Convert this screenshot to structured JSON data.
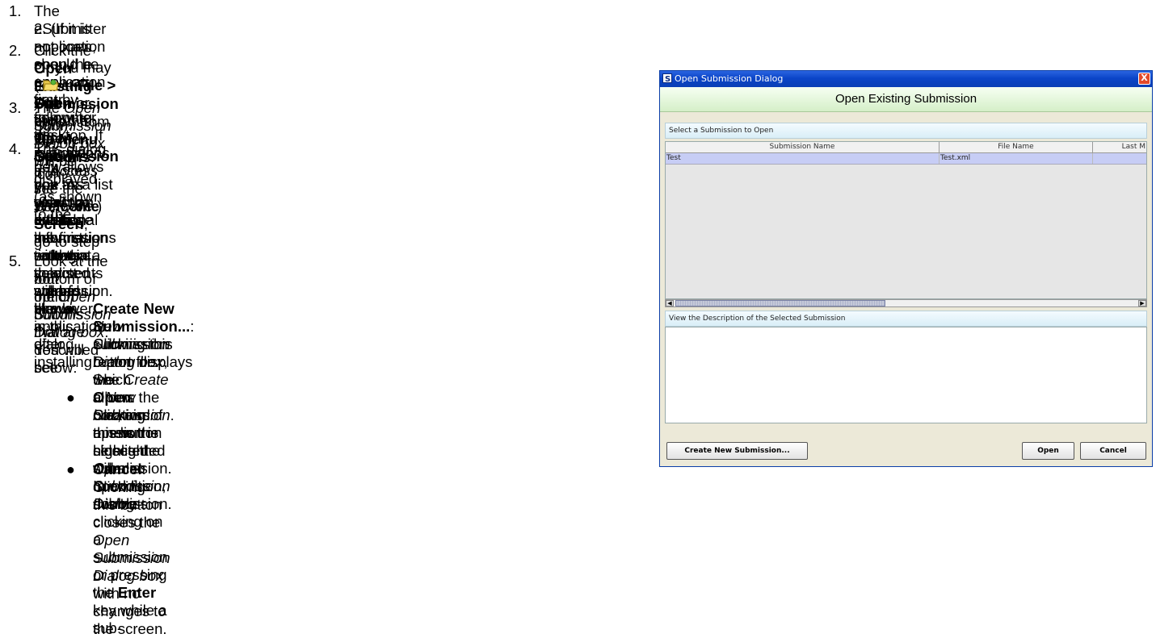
{
  "steps": [
    {
      "num": "1.",
      "lines": [
        [
          "The eSubmitter application should be open on your computer desktop. If it is open, and you see the ",
          {
            "b": "Welcome Screen"
          },
          ", go to step"
        ],
        [
          "2. (If it is not open, open the application first by following the instructions in ",
          {
            "i": "Access the Software"
          },
          ".)"
        ]
      ]
    },
    {
      "num": "2.",
      "lines": [
        [
          "Click the ",
          {
            "b": "Open Existing Submission"
          },
          " button from the ",
          {
            "b": "Menu Options"
          },
          "."
        ],
        [
          "Or you may select ",
          {
            "b": "File > Open"
          },
          " or, click the ",
          {
            "b": "Open Submission"
          },
          " icon"
        ],
        [
          "( ",
          {
            "icon": "folder"
          },
          " ) on the Tool Bar."
        ]
      ]
    },
    {
      "num": "3.",
      "lines": [
        [
          "The ",
          {
            "i": "Open Submission Dialog box"
          },
          " will be displayed (as shown to the"
        ],
        [
          "right)."
        ]
      ]
    },
    {
      "num": "4.",
      "lines": [
        [
          "This dialog box allows you to select an existing submission or begin a"
        ],
        [
          "new one. As you create new reports, they will be shown in this dialog"
        ],
        [
          "box as a list of all the available submissions with a comments area for"
        ],
        [
          "viewing additional information on the selected submission.  However,"
        ],
        [
          "if this is the first time that you started up the application after installing"
        ],
        [
          "the software, the list will be blank."
        ]
      ]
    },
    {
      "num": "5.",
      "lines": [
        [
          "Look at the bottom of the ",
          {
            "i": "Open Submission Dialog box"
          },
          ". You will see"
        ],
        [
          "four option buttons that are described below:"
        ]
      ]
    }
  ],
  "bullets": [
    {
      "lines": [
        [
          {
            "b": "Create New Submission..."
          },
          ": Clicking this button displays the"
        ],
        [
          {
            "i": "New Submission Dialog box"
          },
          ", which allows the creation of a new"
        ],
        [
          "submission report file. See ",
          {
            "i": "Create a New Submission"
          },
          "."
        ]
      ]
    },
    {
      "lines": [
        [
          {
            "b": "Open"
          },
          ": Clicking this button closes the ",
          {
            "i": "Open Submission Dialog"
          }
        ],
        [
          {
            "i": "box"
          },
          ", and opens the selected submission. In addition, double-clicking on a submission or pressing the ",
          {
            "b": "Enter"
          },
          " key while a sub-"
        ],
        [
          "mission is highlighted will also open the submission."
        ]
      ]
    },
    {
      "lines": [
        [
          {
            "b": "Cancel"
          },
          ": Clicking this button closes the ",
          {
            "i": "Open Submission Dialog box"
          },
          " with no changes to the screen."
        ]
      ]
    }
  ],
  "dialog": {
    "title": "Open Submission Dialog",
    "app_icon_letter": "S",
    "close_glyph": "X",
    "header": "Open Existing Submission",
    "select_label": "Select a Submission to Open",
    "columns": [
      "Submission Name",
      "File Name",
      "Last M"
    ],
    "rows": [
      [
        "Test",
        "Test.xml",
        ""
      ]
    ],
    "description_label": "View the Description of the Selected Submission",
    "buttons": {
      "create": "Create New Submission...",
      "open": "Open",
      "cancel": "Cancel"
    },
    "scroll_left": "◀",
    "scroll_right": "▶"
  }
}
